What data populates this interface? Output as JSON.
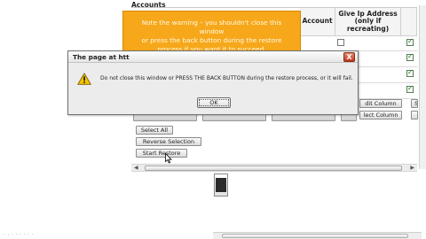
{
  "page": {
    "section_title": "Accounts",
    "status_text": "· . · · · · · ·"
  },
  "table": {
    "headers": {
      "account": "Account",
      "give_ip_line1": "Give Ip Address",
      "give_ip_line2": "(only if",
      "give_ip_line3": "recreating)"
    },
    "give_ip_checked": [
      false,
      false,
      false,
      false
    ],
    "right_col_checked": [
      true,
      true,
      true,
      true
    ]
  },
  "side_buttons": {
    "edit_column": "dit Column",
    "select_column": "lect Column",
    "edge_letter": "S"
  },
  "actions": {
    "select_all": "Select All",
    "reverse_selection": "Reverse Selection",
    "start_restore": "Start Restore"
  },
  "tooltip": {
    "text_line1": "Note the warning – you shouldn't close this window",
    "text_line2": "or press the back button during the restore",
    "text_line3": "process if you want it to succeed."
  },
  "dialog": {
    "title": "The page at htt",
    "close_label": "X",
    "message": "Do not close this window or PRESS THE BACK BUTTON during the restore process, or it will fail.",
    "ok_label": "OK"
  },
  "colors": {
    "tooltip_bg": "#f7a71a",
    "close_button": "#c0391e",
    "warning_icon": "#f2c500"
  }
}
